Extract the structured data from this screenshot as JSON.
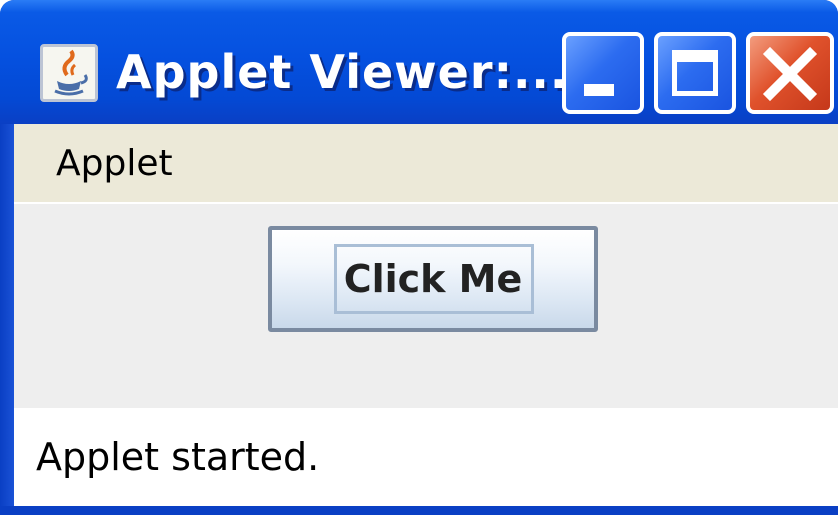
{
  "window": {
    "title": "Applet Viewer:...",
    "icon": "java-cup-icon",
    "controls": [
      "minimize-icon",
      "maximize-icon",
      "close-icon"
    ]
  },
  "menubar": {
    "items": [
      {
        "label": "Applet"
      }
    ]
  },
  "content": {
    "button_label": "Click Me"
  },
  "status": {
    "text": "Applet started."
  },
  "colors": {
    "titlebar": "#0551e0",
    "close_button": "#e0522c",
    "menubar": "#ece9d8",
    "content": "#eeeeee"
  }
}
